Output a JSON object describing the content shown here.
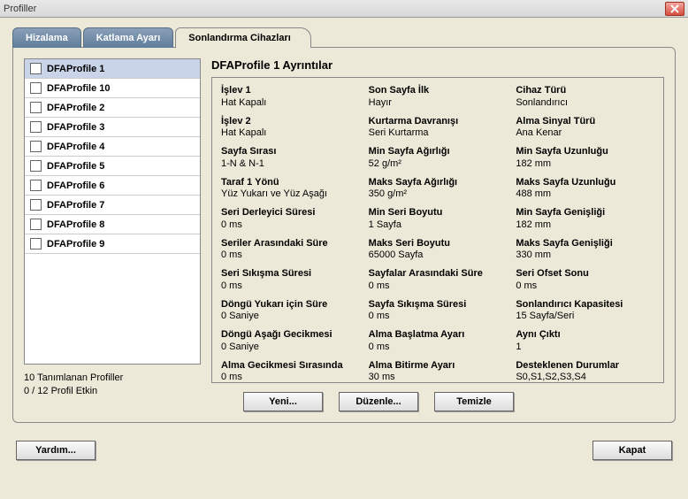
{
  "window": {
    "title": "Profiller"
  },
  "tabs": {
    "alignment": "Hizalama",
    "fold": "Katlama Ayarı",
    "finishing": "Sonlandırma Cihazları"
  },
  "profiles": {
    "items": [
      {
        "label": "DFAProfile 1",
        "selected": true,
        "checked": false
      },
      {
        "label": "DFAProfile 10",
        "selected": false,
        "checked": false
      },
      {
        "label": "DFAProfile 2",
        "selected": false,
        "checked": false
      },
      {
        "label": "DFAProfile 3",
        "selected": false,
        "checked": false
      },
      {
        "label": "DFAProfile 4",
        "selected": false,
        "checked": false
      },
      {
        "label": "DFAProfile 5",
        "selected": false,
        "checked": false
      },
      {
        "label": "DFAProfile 6",
        "selected": false,
        "checked": false
      },
      {
        "label": "DFAProfile 7",
        "selected": false,
        "checked": false
      },
      {
        "label": "DFAProfile 8",
        "selected": false,
        "checked": false
      },
      {
        "label": "DFAProfile 9",
        "selected": false,
        "checked": false
      }
    ],
    "count_defined": "10 Tanımlanan Profiller",
    "count_active": "0 / 12 Profil Etkin"
  },
  "details": {
    "title": "DFAProfile 1 Ayrıntılar",
    "col1": [
      {
        "label": "İşlev 1",
        "value": "Hat Kapalı"
      },
      {
        "label": "İşlev 2",
        "value": "Hat Kapalı"
      },
      {
        "label": "Sayfa Sırası",
        "value": "1-N & N-1"
      },
      {
        "label": "Taraf 1 Yönü",
        "value": "Yüz Yukarı ve Yüz Aşağı"
      },
      {
        "label": "Seri Derleyici Süresi",
        "value": "0 ms"
      },
      {
        "label": "Seriler Arasındaki Süre",
        "value": "0 ms"
      },
      {
        "label": "Seri Sıkışma Süresi",
        "value": "0 ms"
      },
      {
        "label": "Döngü Yukarı için Süre",
        "value": "0 Saniye"
      },
      {
        "label": "Döngü Aşağı Gecikmesi",
        "value": "0 Saniye"
      },
      {
        "label": "Alma Gecikmesi Sırasında",
        "value": "0 ms"
      }
    ],
    "col2": [
      {
        "label": "Son Sayfa İlk",
        "value": "Hayır"
      },
      {
        "label": "Kurtarma Davranışı",
        "value": "Seri Kurtarma"
      },
      {
        "label": "Min Sayfa Ağırlığı",
        "value": "52 g/m²"
      },
      {
        "label": "Maks Sayfa Ağırlığı",
        "value": "350 g/m²"
      },
      {
        "label": "Min Seri Boyutu",
        "value": "1 Sayfa"
      },
      {
        "label": "Maks Seri Boyutu",
        "value": "65000 Sayfa"
      },
      {
        "label": "Sayfalar Arasındaki Süre",
        "value": "0 ms"
      },
      {
        "label": "Sayfa Sıkışma Süresi",
        "value": "0 ms"
      },
      {
        "label": "Alma Başlatma Ayarı",
        "value": "0 ms"
      },
      {
        "label": "Alma Bitirme Ayarı",
        "value": "30 ms"
      }
    ],
    "col3": [
      {
        "label": "Cihaz Türü",
        "value": "Sonlandırıcı"
      },
      {
        "label": "Alma Sinyal Türü",
        "value": "Ana Kenar"
      },
      {
        "label": "Min Sayfa Uzunluğu",
        "value": "182 mm"
      },
      {
        "label": "Maks Sayfa Uzunluğu",
        "value": "488 mm"
      },
      {
        "label": "Min Sayfa Genişliği",
        "value": "182 mm"
      },
      {
        "label": "Maks Sayfa Genişliği",
        "value": "330 mm"
      },
      {
        "label": "Seri Ofset Sonu",
        "value": "0 ms"
      },
      {
        "label": "Sonlandırıcı Kapasitesi",
        "value": "15 Sayfa/Seri"
      },
      {
        "label": "Aynı Çıktı",
        "value": "1"
      },
      {
        "label": "Desteklenen Durumlar",
        "value": "S0,S1,S2,S3,S4"
      }
    ]
  },
  "buttons": {
    "new": "Yeni...",
    "edit": "Düzenle...",
    "clear": "Temizle",
    "help": "Yardım...",
    "close": "Kapat"
  }
}
